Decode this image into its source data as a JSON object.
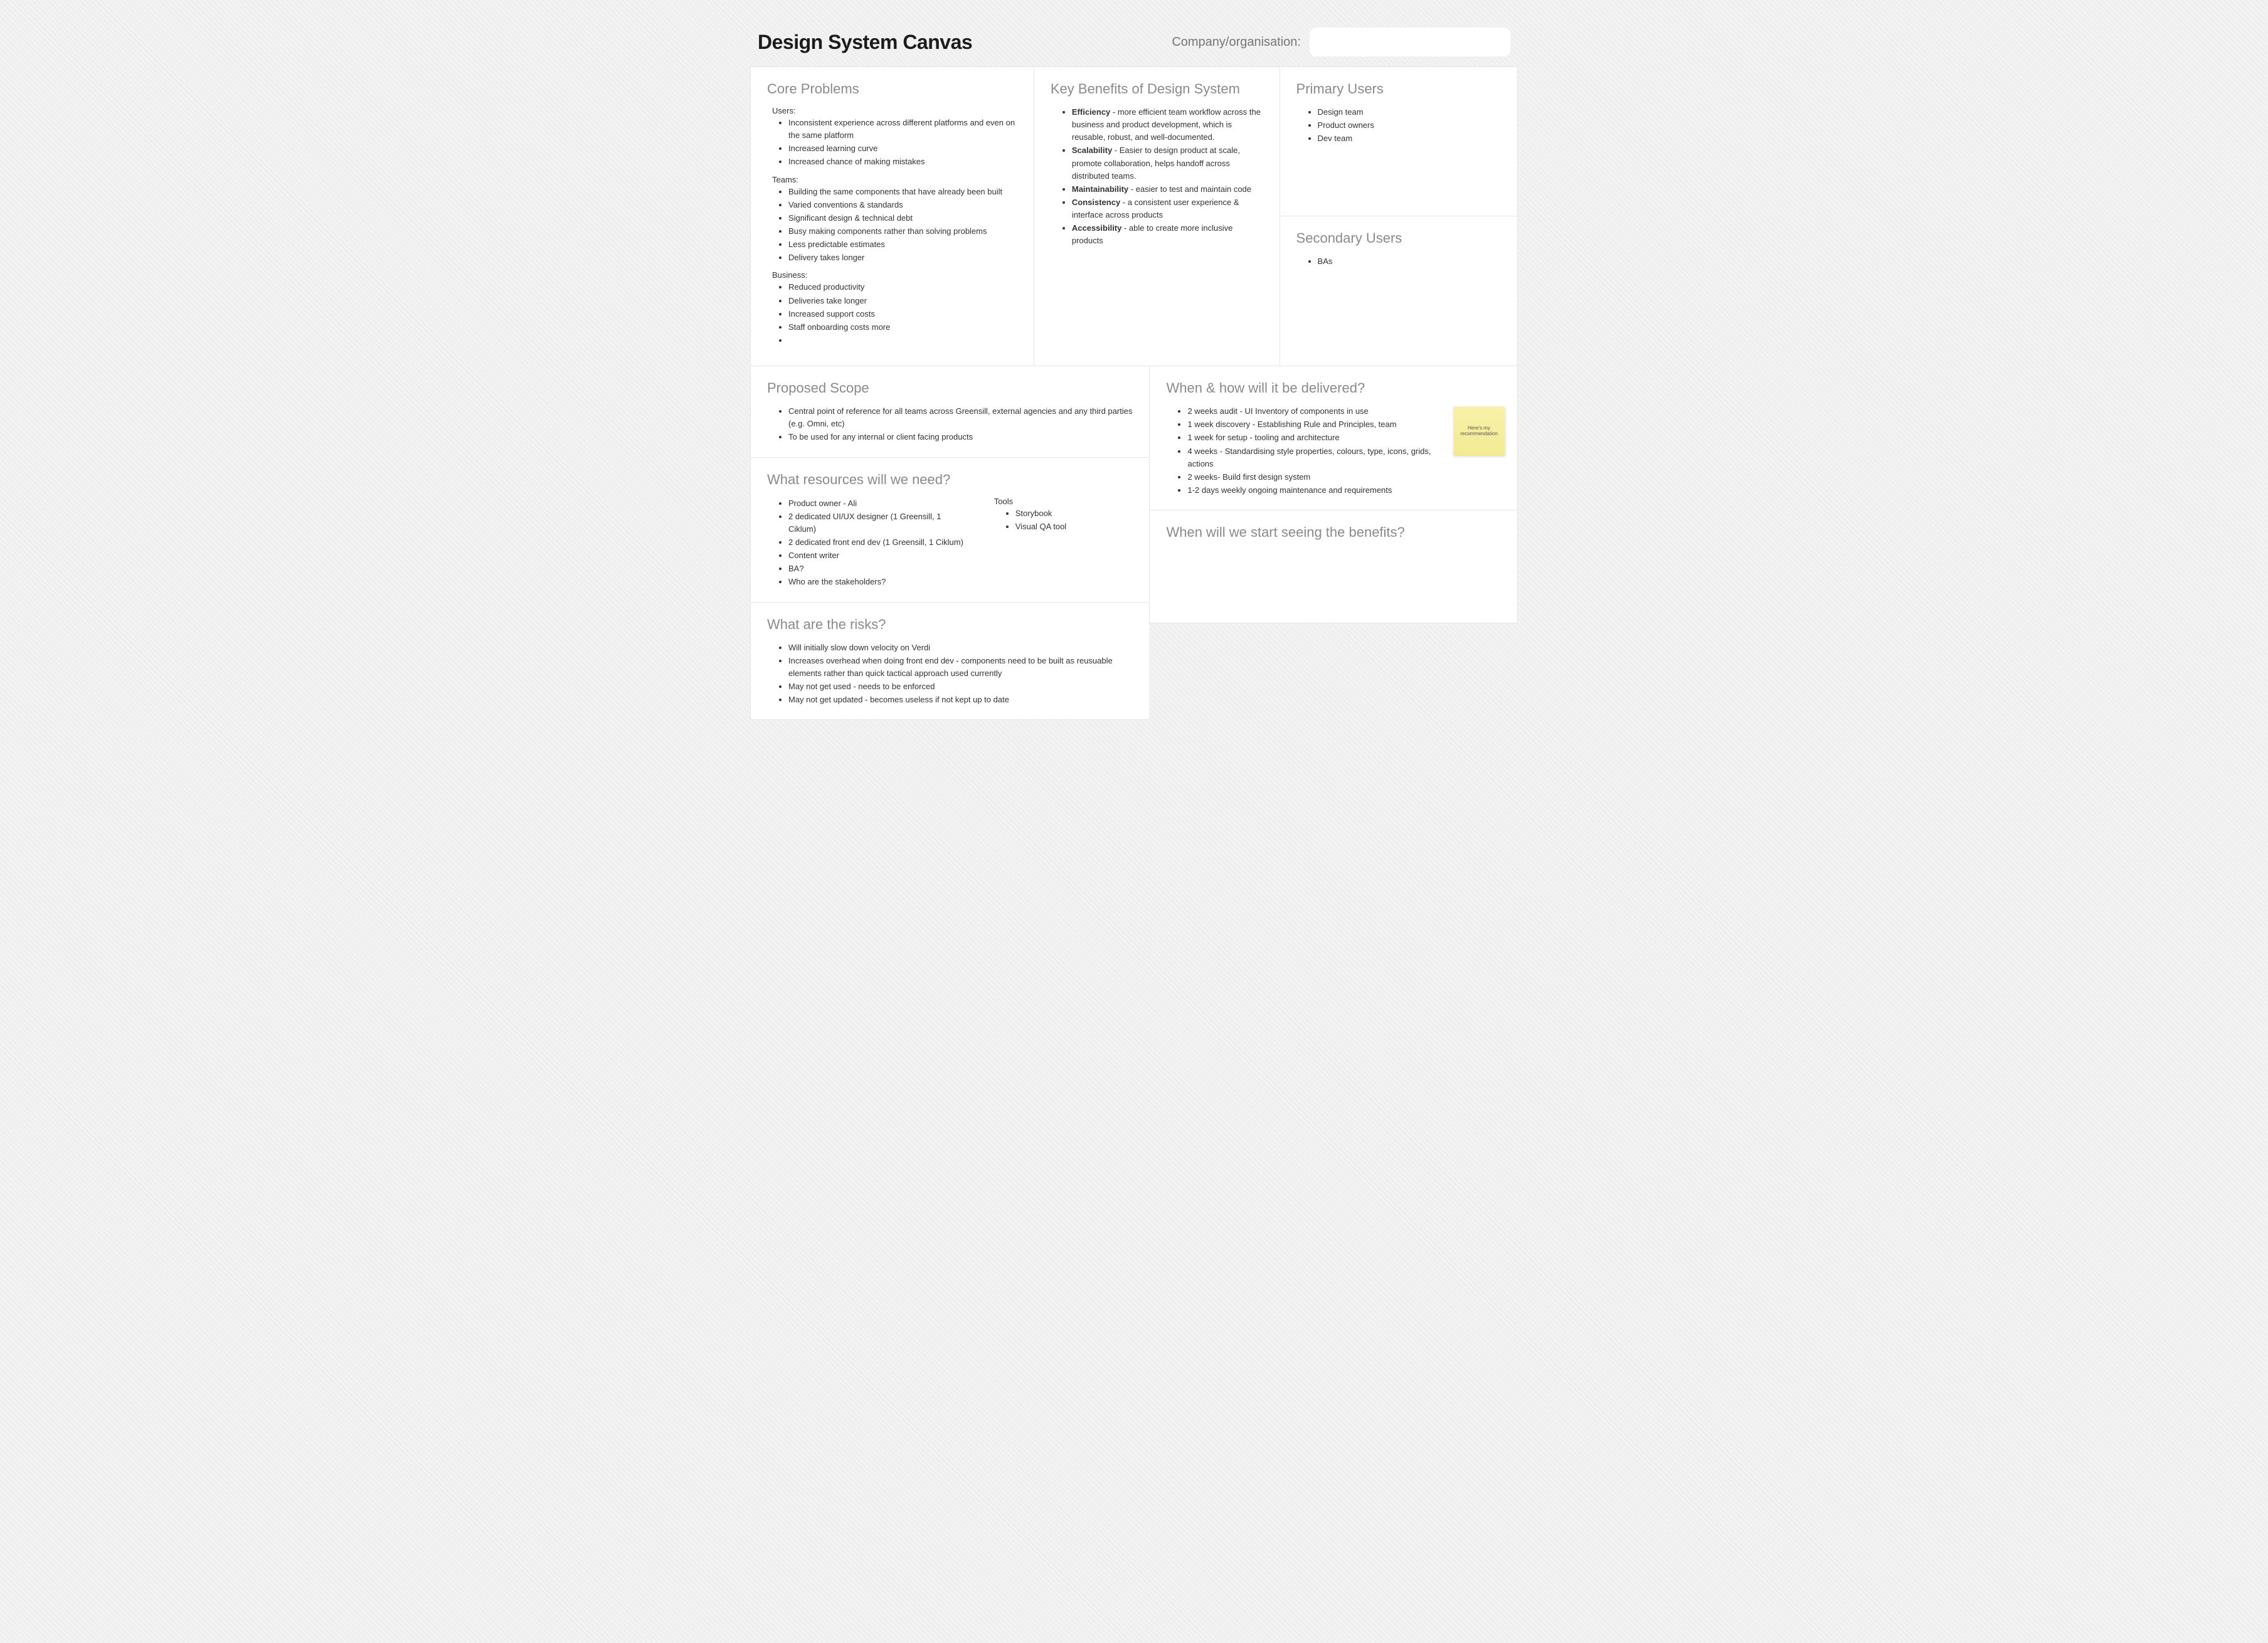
{
  "header": {
    "title": "Design System Canvas",
    "org_label": "Company/organisation:",
    "org_value": ""
  },
  "coreProblems": {
    "heading": "Core Problems",
    "groups": [
      {
        "label": "Users:",
        "items": [
          "Inconsistent experience across different platforms and even on the same platform",
          "Increased learning curve",
          "Increased chance of making mistakes"
        ]
      },
      {
        "label": "Teams:",
        "items": [
          "Building the same components that have already been built",
          "Varied conventions & standards",
          "Significant design & technical debt",
          "Busy making components rather than solving problems",
          "Less predictable estimates",
          "Delivery takes longer"
        ]
      },
      {
        "label": "Business:",
        "items": [
          "Reduced productivity",
          "Deliveries take longer",
          "Increased support costs",
          "Staff onboarding costs more",
          ""
        ]
      }
    ]
  },
  "keyBenefits": {
    "heading": "Key Benefits of Design System",
    "items": [
      {
        "bold": "Efficiency",
        "rest": " - more efficient team workflow across the business and product development, which is reusable, robust, and well-documented."
      },
      {
        "bold": "Scalability",
        "rest": " - Easier to design product at scale, promote collaboration, helps handoff across distributed teams."
      },
      {
        "bold": "Maintainability",
        "rest": " - easier to test and maintain code"
      },
      {
        "bold": "Consistency",
        "rest": " - a consistent user experience & interface across products"
      },
      {
        "bold": "Accessibility",
        "rest": " - able to create more inclusive products"
      }
    ]
  },
  "primaryUsers": {
    "heading": "Primary Users",
    "items": [
      "Design team",
      "Product owners",
      "Dev team"
    ]
  },
  "secondaryUsers": {
    "heading": "Secondary Users",
    "items": [
      "BAs"
    ]
  },
  "scope": {
    "heading": "Proposed Scope",
    "items": [
      "Central point of reference for all teams across Greensill, external agencies and any third parties (e.g. Omni, etc)",
      "To be used for any internal or client facing products"
    ]
  },
  "resources": {
    "heading": "What resources will we need?",
    "people": [
      "Product owner - Ali",
      "2 dedicated UI/UX designer (1 Greensill, 1 Ciklum)",
      "2 dedicated front end dev  (1 Greensill, 1 Ciklum)",
      "Content writer",
      "BA?",
      "Who are the stakeholders?"
    ],
    "tools_label": "Tools",
    "tools": [
      "Storybook",
      "Visual QA tool"
    ]
  },
  "risks": {
    "heading": "What are the risks?",
    "items": [
      "Will initially slow down velocity on Verdi",
      "Increases overhead when doing front end dev - components need to be built as reusuable elements rather than quick tactical approach used currently",
      "May not get used - needs to be enforced",
      "May not get updated - becomes useless if not kept up to date"
    ]
  },
  "delivery": {
    "heading": "When & how will it be delivered?",
    "items": [
      "2 weeks audit - UI Inventory of components in use",
      "1 week discovery - Establishing Rule and Principles, team",
      "1 week for setup - tooling and architecture",
      "4 weeks - Standardising style properties, colours, type, icons, grids, actions",
      "2 weeks- Build first design system",
      "1-2 days weekly ongoing maintenance and requirements"
    ],
    "sticky": "Here's my recommendation"
  },
  "seeBenefits": {
    "heading": "When will we start seeing the benefits?"
  }
}
